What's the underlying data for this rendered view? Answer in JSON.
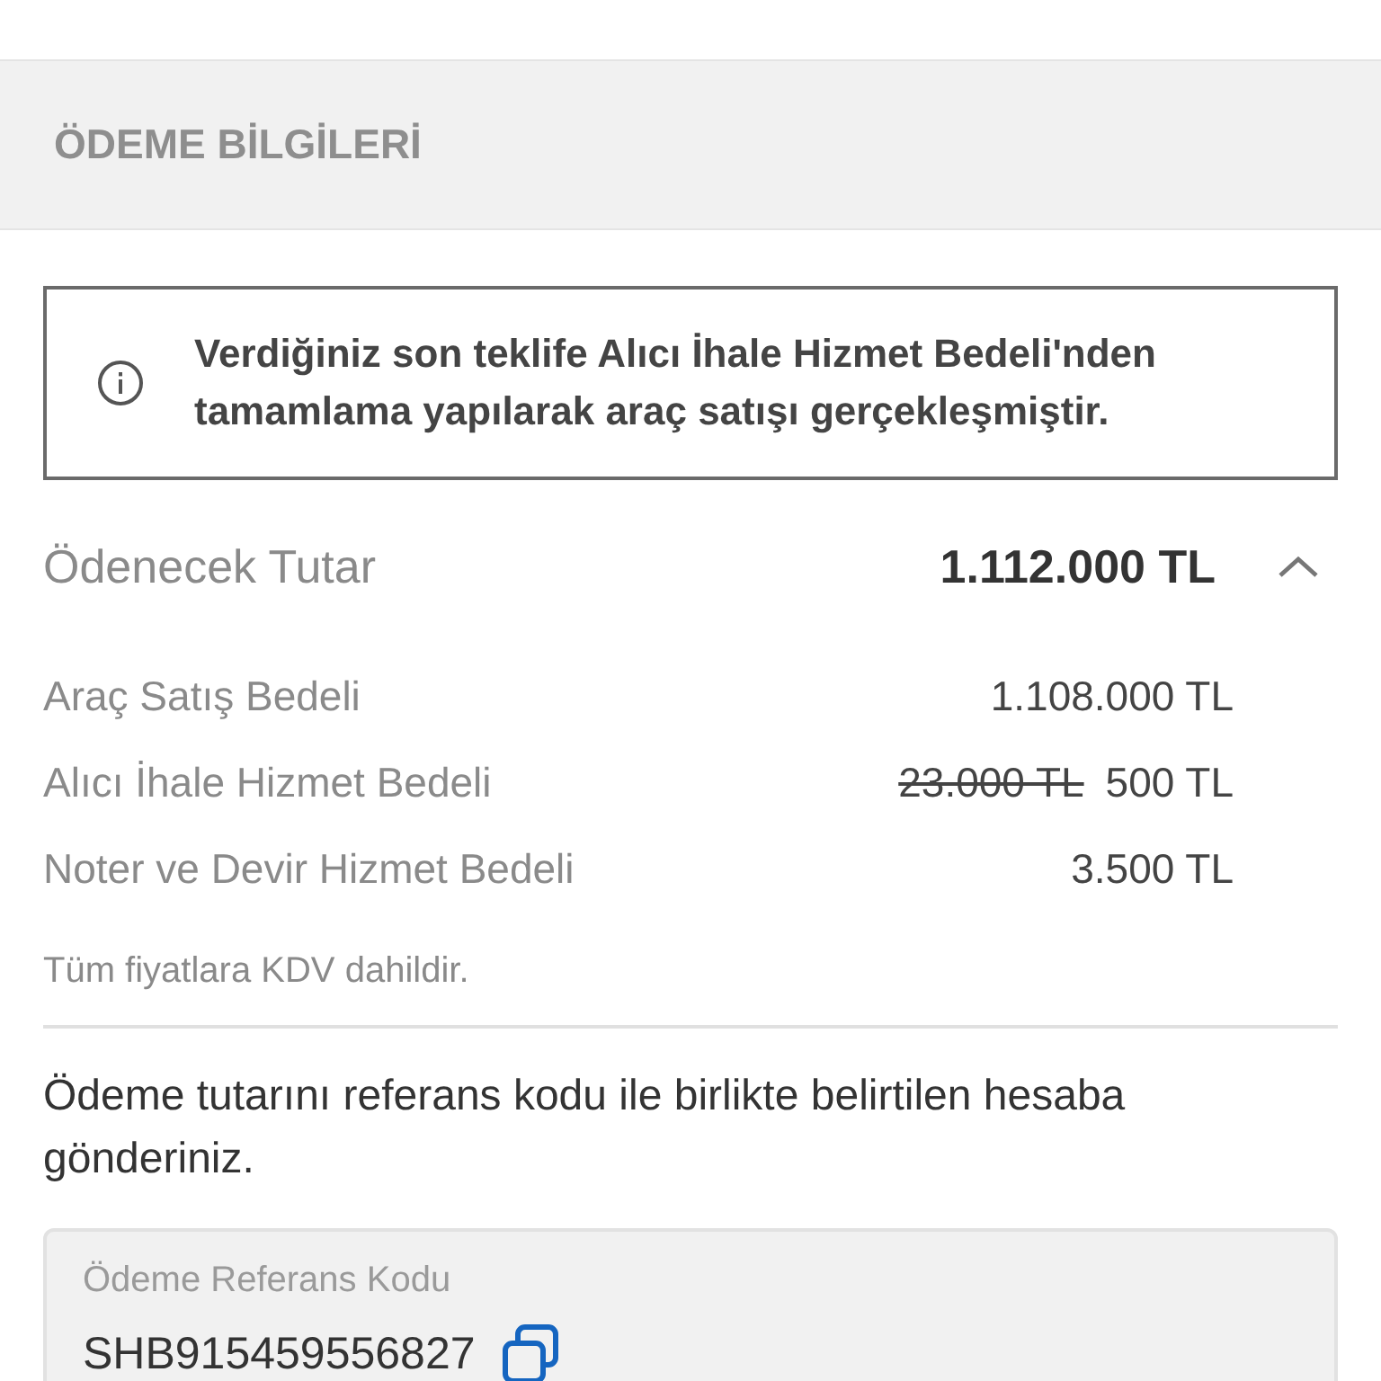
{
  "section_title": "ÖDEME BİLGİLERİ",
  "info": {
    "text": "Verdiğiniz son teklife Alıcı İhale Hizmet Bedeli'nden tamamlama yapılarak araç satışı gerçekleşmiştir."
  },
  "total": {
    "label": "Ödenecek Tutar",
    "amount": "1.112.000 TL",
    "expanded": true
  },
  "breakdown": [
    {
      "label": "Araç Satış Bedeli",
      "amount": "1.108.000 TL"
    },
    {
      "label": "Alıcı İhale Hizmet Bedeli",
      "old_amount": "23.000 TL",
      "amount": "500 TL"
    },
    {
      "label": "Noter ve Devir Hizmet Bedeli",
      "amount": "3.500 TL"
    }
  ],
  "vat_note": "Tüm fiyatlara KDV dahildir.",
  "instruction": "Ödeme tutarını referans kodu ile birlikte belirtilen hesaba gönderiniz.",
  "reference": {
    "label": "Ödeme Referans Kodu",
    "code": "SHB915459556827"
  }
}
